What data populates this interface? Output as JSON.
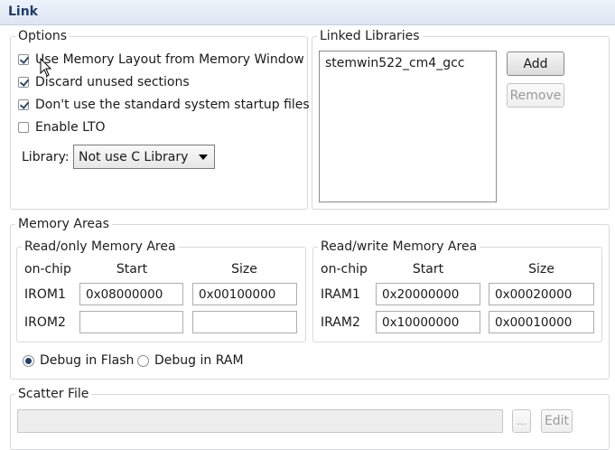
{
  "page": {
    "title": "Link"
  },
  "options": {
    "legend": "Options",
    "checkboxes": [
      {
        "label": "Use Memory Layout from Memory Window",
        "checked": true
      },
      {
        "label": "Discard unused sections",
        "checked": true
      },
      {
        "label": "Don't use the standard system startup files",
        "checked": true
      },
      {
        "label": "Enable LTO",
        "checked": false
      }
    ],
    "library_label": "Library:",
    "library_value": "Not use C Library"
  },
  "linked": {
    "legend": "Linked Libraries",
    "items": [
      "stemwin522_cm4_gcc"
    ],
    "add_label": "Add",
    "remove_label": "Remove"
  },
  "memory": {
    "legend": "Memory Areas",
    "ro": {
      "legend": "Read/only Memory Area",
      "col_onchip": "on-chip",
      "col_start": "Start",
      "col_size": "Size",
      "rows": [
        {
          "name": "IROM1",
          "start": "0x08000000",
          "size": "0x00100000"
        },
        {
          "name": "IROM2",
          "start": "",
          "size": ""
        }
      ]
    },
    "rw": {
      "legend": "Read/write Memory Area",
      "col_onchip": "on-chip",
      "col_start": "Start",
      "col_size": "Size",
      "rows": [
        {
          "name": "IRAM1",
          "start": "0x20000000",
          "size": "0x00020000"
        },
        {
          "name": "IRAM2",
          "start": "0x10000000",
          "size": "0x00010000"
        }
      ]
    },
    "debug_flash_label": "Debug in Flash",
    "debug_ram_label": "Debug in RAM",
    "debug_selected": "flash"
  },
  "scatter": {
    "legend": "Scatter File",
    "path": "",
    "browse_label": "...",
    "edit_label": "Edit"
  }
}
